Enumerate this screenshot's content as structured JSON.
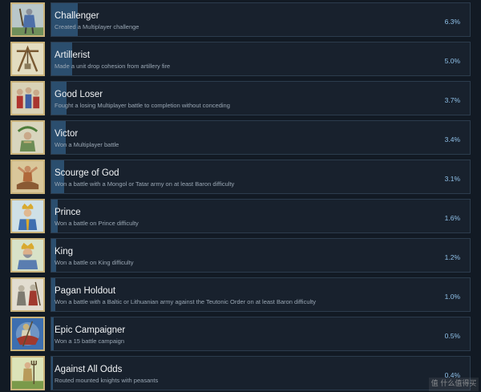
{
  "achievements": [
    {
      "title": "Challenger",
      "description": "Created a Multiplayer challenge",
      "percent_label": "6.3%",
      "percent": 6.3,
      "icon": "knight-standing-icon"
    },
    {
      "title": "Artillerist",
      "description": "Made a unit drop cohesion from artillery fire",
      "percent_label": "5.0%",
      "percent": 5.0,
      "icon": "trebuchet-icon"
    },
    {
      "title": "Good Loser",
      "description": "Fought a losing Multiplayer battle to completion without conceding",
      "percent_label": "3.7%",
      "percent": 3.7,
      "icon": "soldiers-group-icon"
    },
    {
      "title": "Victor",
      "description": "Won a Multiplayer battle",
      "percent_label": "3.4%",
      "percent": 3.4,
      "icon": "laurel-king-icon"
    },
    {
      "title": "Scourge of God",
      "description": "Won a battle with a Mongol or Tatar army on at least Baron difficulty",
      "percent_label": "3.1%",
      "percent": 3.1,
      "icon": "mongol-horseman-icon"
    },
    {
      "title": "Prince",
      "description": "Won a battle on Prince difficulty",
      "percent_label": "1.6%",
      "percent": 1.6,
      "icon": "prince-portrait-icon"
    },
    {
      "title": "King",
      "description": "Won a battle on King difficulty",
      "percent_label": "1.2%",
      "percent": 1.2,
      "icon": "crowned-king-icon"
    },
    {
      "title": "Pagan Holdout",
      "description": "Won a battle with a Baltic or Lithuanian army against the Teutonic Order on at least Baron difficulty",
      "percent_label": "1.0%",
      "percent": 1.0,
      "icon": "pagan-warriors-icon"
    },
    {
      "title": "Epic Campaigner",
      "description": "Won a 15 battle campaign",
      "percent_label": "0.5%",
      "percent": 0.5,
      "icon": "mounted-knight-icon"
    },
    {
      "title": "Against All Odds",
      "description": "Routed mounted knights with peasants",
      "percent_label": "0.4%",
      "percent": 0.4,
      "icon": "peasant-pitchfork-icon"
    }
  ],
  "watermark": "值 什么值得买",
  "colors": {
    "background": "#121a24",
    "panel": "#18212d",
    "bar": "#2b4e6e",
    "percent_text": "#8fc0e8",
    "icon_border": "#c9b27a"
  }
}
